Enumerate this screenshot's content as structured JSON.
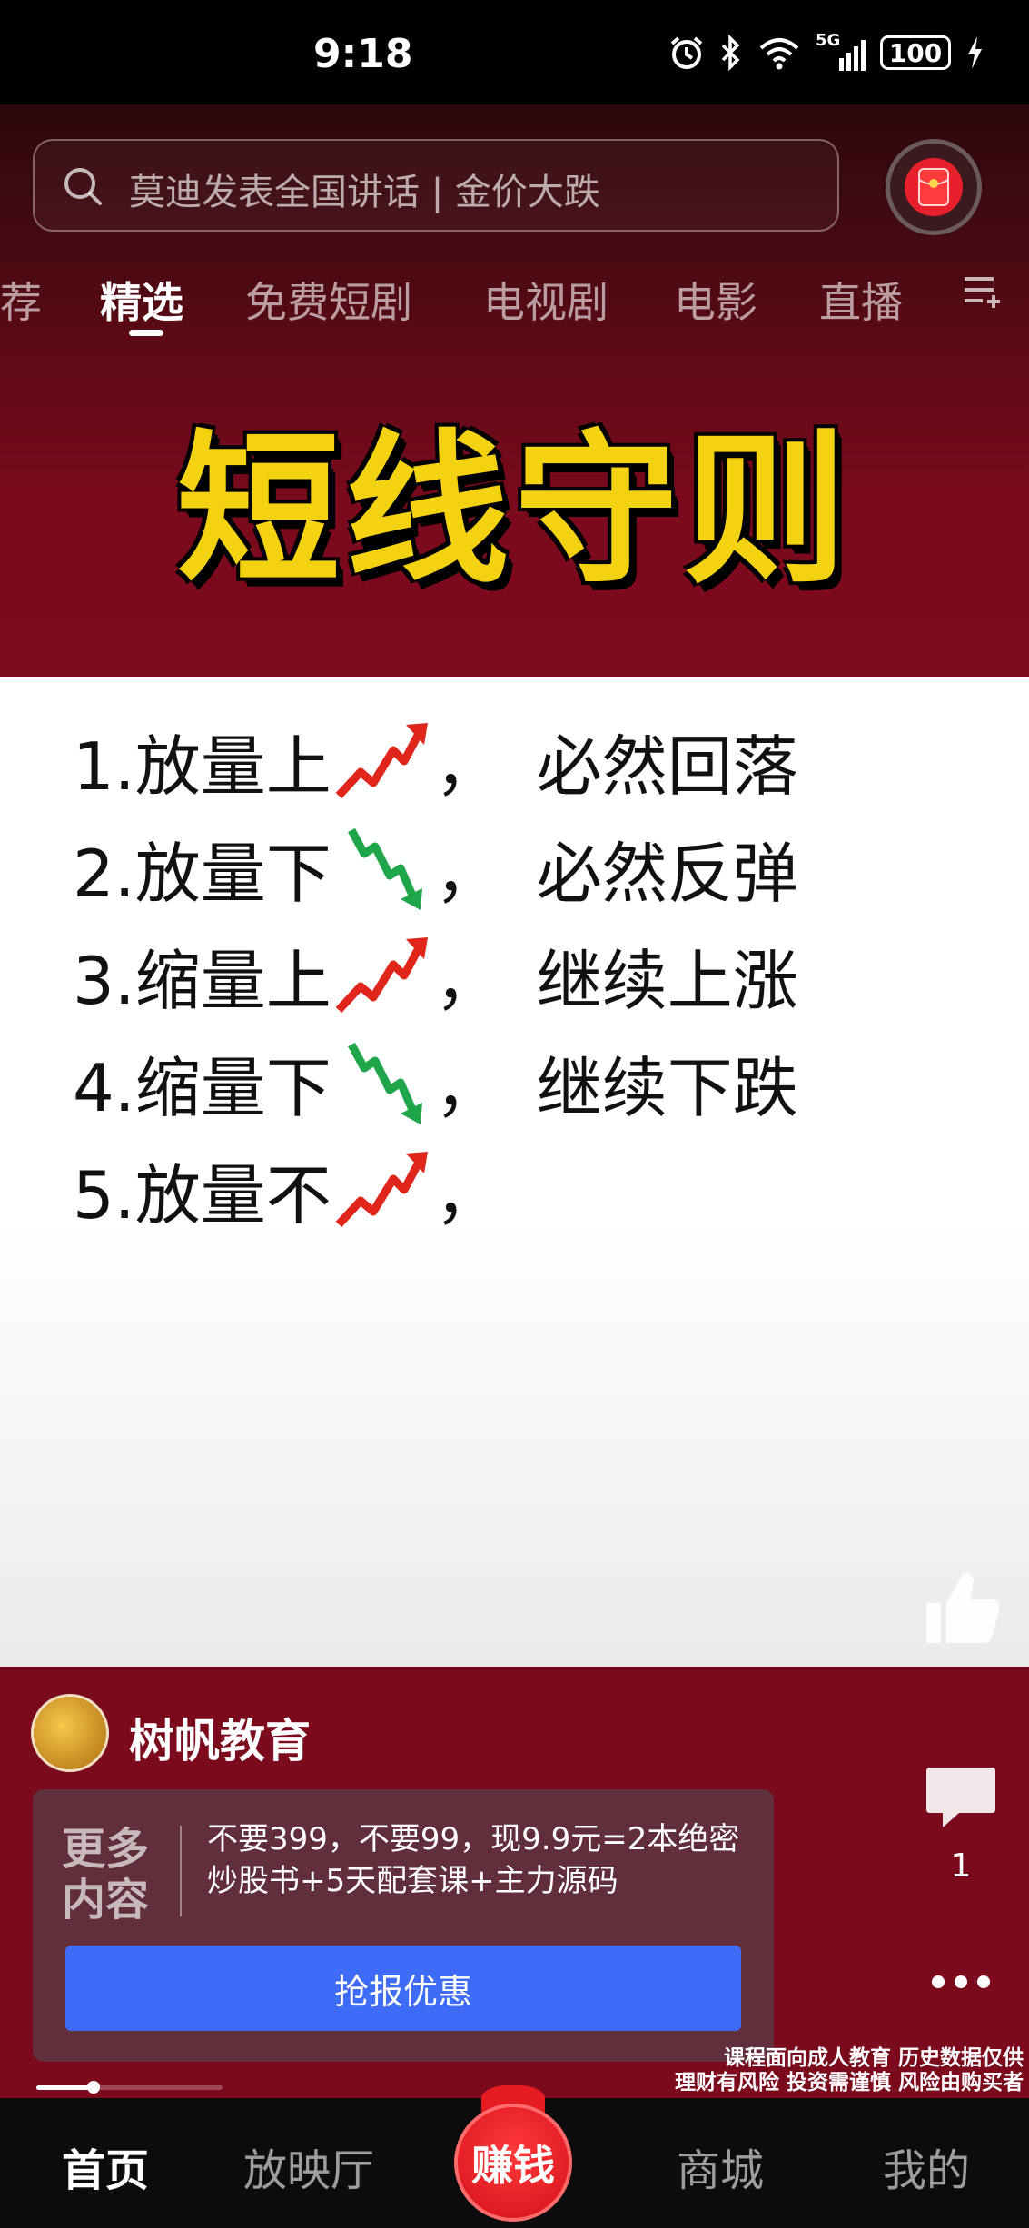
{
  "status_bar": {
    "time": "9:18",
    "network": "5G",
    "battery": "100"
  },
  "search": {
    "placeholder": "莫迪发表全国讲话 | 金价大跌"
  },
  "tabs": [
    {
      "label": "荐",
      "active": false
    },
    {
      "label": "精选",
      "active": true
    },
    {
      "label": "免费短剧",
      "active": false
    },
    {
      "label": "电视剧",
      "active": false
    },
    {
      "label": "电影",
      "active": false
    },
    {
      "label": "直播",
      "active": false
    }
  ],
  "video": {
    "title": "短线守则",
    "rules": [
      {
        "prefix": "1.放量上",
        "arrow": "up",
        "suffix": "必然回落"
      },
      {
        "prefix": "2.放量下",
        "arrow": "down",
        "suffix": "必然反弹"
      },
      {
        "prefix": "3.缩量上",
        "arrow": "up",
        "suffix": "继续上涨"
      },
      {
        "prefix": "4.缩量下",
        "arrow": "down",
        "suffix": "继续下跌"
      },
      {
        "prefix": "5.放量不",
        "arrow": "up",
        "suffix": ""
      }
    ]
  },
  "actions": {
    "like_label": "点赞",
    "comment_count": "1"
  },
  "author": {
    "name": "树帆教育"
  },
  "promo": {
    "badge_line1": "更多",
    "badge_line2": "内容",
    "text": "不要399，不要99，现9.9元=2本绝密炒股书+5天配套课+主力源码",
    "button_label": "抢报优惠"
  },
  "disclaimer": {
    "line1": "课程面向成人教育 历史数据仅供",
    "line2": "理财有风险 投资需谨慎 风险由购买者"
  },
  "progress": 0.3,
  "bottom_nav": {
    "home": "首页",
    "theater": "放映厅",
    "earn": "赚钱",
    "mall": "商城",
    "mine": "我的"
  },
  "colors": {
    "accent_blue": "#3f6cf7",
    "panel_red": "#7a0a1c",
    "title_yellow": "#f2d211",
    "arrow_up": "#e0261a",
    "arrow_down": "#1fa64a"
  }
}
